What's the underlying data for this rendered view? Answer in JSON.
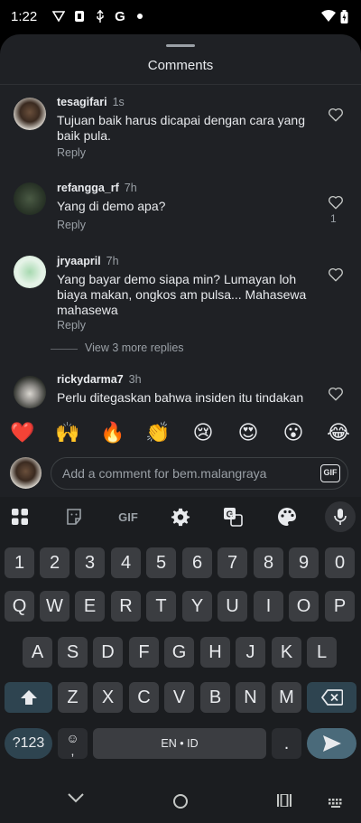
{
  "status_bar": {
    "time": "1:22",
    "icons": [
      "vpn-icon",
      "notification-icon",
      "usb-icon",
      "google-icon",
      "dot-icon"
    ],
    "right_icons": [
      "wifi-icon",
      "battery-icon"
    ]
  },
  "sheet": {
    "title": "Comments"
  },
  "comments": [
    {
      "user": "tesagifari",
      "time": "1s",
      "text": "Tujuan baik harus dicapai dengan cara yang baik pula.",
      "reply": "Reply",
      "likes": ""
    },
    {
      "user": "refangga_rf",
      "time": "7h",
      "text": "Yang di demo apa?",
      "reply": "Reply",
      "likes": "1"
    },
    {
      "user": "jryaapril",
      "time": "7h",
      "text": "Yang bayar demo siapa min? Lumayan loh biaya makan, ongkos am pulsa... Mahasewa mahasewa",
      "reply": "Reply",
      "likes": ""
    },
    {
      "user": "rickydarma7",
      "time": "3h",
      "text": "Perlu ditegaskan bahwa insiden itu tindakan",
      "reply": "",
      "likes": ""
    }
  ],
  "more_replies": "View 3 more replies",
  "emoji_bar": [
    "❤️",
    "🙌",
    "🔥",
    "👏",
    "😢",
    "😍",
    "😮",
    "😂"
  ],
  "comment_input": {
    "placeholder": "Add a comment for bem.malangraya",
    "gif_label": "GIF"
  },
  "keyboard": {
    "toolbar": {
      "gif_label": "GIF"
    },
    "row_numbers": [
      "1",
      "2",
      "3",
      "4",
      "5",
      "6",
      "7",
      "8",
      "9",
      "0"
    ],
    "row_top": [
      "Q",
      "W",
      "E",
      "R",
      "T",
      "Y",
      "U",
      "I",
      "O",
      "P"
    ],
    "row_mid": [
      "A",
      "S",
      "D",
      "F",
      "G",
      "H",
      "J",
      "K",
      "L"
    ],
    "row_bottom": [
      "Z",
      "X",
      "C",
      "V",
      "B",
      "N",
      "M"
    ],
    "symbols_label": "?123",
    "emoji_comma": ",",
    "space_label": "EN • ID",
    "period_label": "."
  }
}
